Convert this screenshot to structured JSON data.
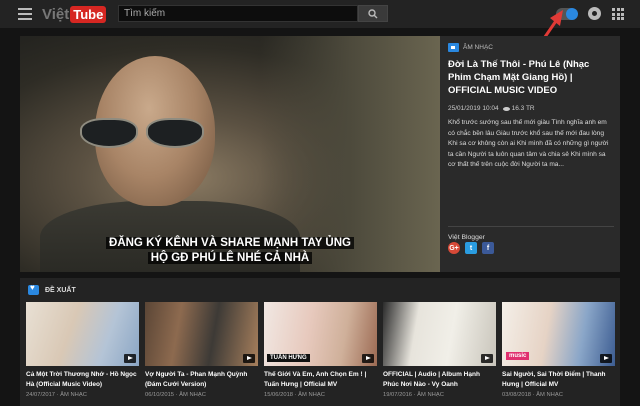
{
  "header": {
    "logo_part1": "Việt",
    "logo_part2": "Tube",
    "search_placeholder": "Tìm kiếm",
    "icons": [
      "menu-icon",
      "search-icon",
      "toggle-switch",
      "notification-icon",
      "apps-grid-icon"
    ],
    "toggle_color": "#2a88e0"
  },
  "featured": {
    "caption_line1": "ĐĂNG KÝ KÊNH VÀ SHARE MẠNH TAY ỦNG",
    "caption_line2": "HỘ GĐ PHÚ LÊ NHÉ CẢ NHÀ",
    "category": "ÂM NHẠC",
    "title": "Đời Là Thế Thôi - Phú Lê (Nhạc Phim Chạm Mặt Giang Hồ) | OFFICIAL MUSIC VIDEO",
    "date": "25/01/2019 10:04",
    "views": "16.3 TR",
    "description": "Khổ trước sướng sau thế mới giàu Tình nghĩa anh em có chắc bền lâu Giàu trước khổ sau thế mới đau lòng Khi sa cơ không còn ai Khi mình đã có những gì người ta cần Người ta luôn quan tâm và chia sẻ Khi mình sa cơ thất thế trên cuộc đời Người ta ma...",
    "author": "Việt Blogger",
    "share": {
      "google": "G+",
      "twitter": "t",
      "facebook": "f"
    }
  },
  "recommended": {
    "heading": "ĐỀ XUẤT",
    "items": [
      {
        "title": "Cả Một Trời Thương Nhớ - Hồ Ngọc Hà (Official Music Video)",
        "date": "24/07/2017",
        "category": "ÂM NHẠC"
      },
      {
        "title": "Vợ Người Ta - Phan Mạnh Quỳnh (Đám Cưới Version)",
        "date": "06/10/2015",
        "category": "ÂM NHẠC"
      },
      {
        "title": "Thế Giới Và Em, Anh Chọn Em ! | Tuấn Hưng | Official MV",
        "date": "15/06/2018",
        "category": "ÂM NHẠC",
        "overlay": "TUẤN HƯNG"
      },
      {
        "title": "OFFICIAL | Audio | Album Hạnh Phúc Nơi Nào - Vy Oanh",
        "date": "19/07/2016",
        "category": "ÂM NHẠC"
      },
      {
        "title": "Sai Người, Sai Thời Điểm | Thanh Hưng | Official MV",
        "date": "03/08/2018",
        "category": "ÂM NHẠC",
        "overlay": "music"
      }
    ]
  }
}
